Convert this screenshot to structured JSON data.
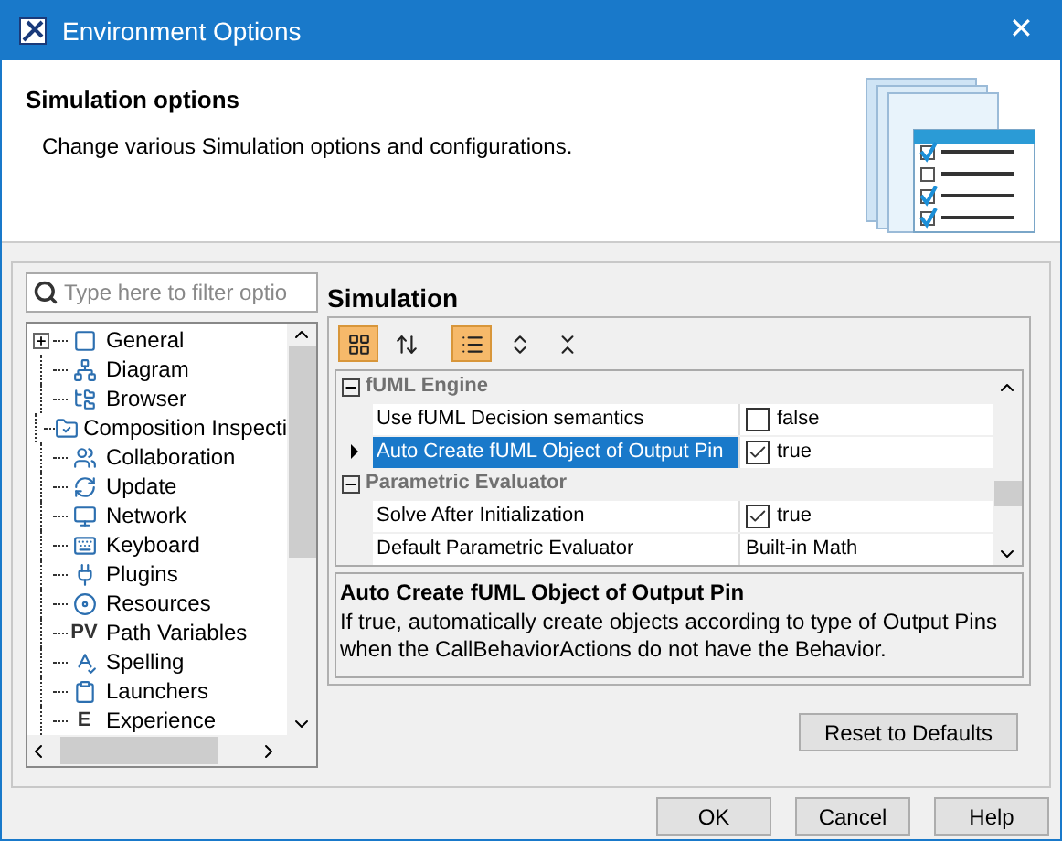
{
  "window": {
    "title": "Environment Options",
    "close": "✕"
  },
  "header": {
    "title": "Simulation options",
    "description": "Change various Simulation options and configurations."
  },
  "search": {
    "placeholder": "Type here to filter optio"
  },
  "tree": [
    {
      "label": "General",
      "expandable": true
    },
    {
      "label": "Diagram"
    },
    {
      "label": "Browser"
    },
    {
      "label": "Composition Inspecti"
    },
    {
      "label": "Collaboration"
    },
    {
      "label": "Update"
    },
    {
      "label": "Network"
    },
    {
      "label": "Keyboard"
    },
    {
      "label": "Plugins"
    },
    {
      "label": "Resources"
    },
    {
      "label": "Path Variables",
      "icon_text": "PV"
    },
    {
      "label": "Spelling"
    },
    {
      "label": "Launchers"
    },
    {
      "label": "Experience",
      "icon_text": "E"
    }
  ],
  "panel": {
    "title": "Simulation",
    "toolbar": [
      {
        "selected": true
      },
      {
        "selected": false
      },
      {
        "selected": true
      },
      {
        "selected": false
      },
      {
        "selected": false
      }
    ],
    "groups": [
      {
        "name": "fUML Engine",
        "expanded": true,
        "rows": [
          {
            "name": "Use fUML Decision semantics",
            "kind": "checkbox",
            "checked": false,
            "value": "false",
            "selected": false
          },
          {
            "name": "Auto Create fUML Object of Output Pin",
            "kind": "checkbox",
            "checked": true,
            "value": "true",
            "selected": true
          }
        ]
      },
      {
        "name": "Parametric Evaluator",
        "expanded": true,
        "rows": [
          {
            "name": "Solve After Initialization",
            "kind": "checkbox",
            "checked": true,
            "value": "true",
            "selected": false
          },
          {
            "name": "Default Parametric Evaluator",
            "kind": "text",
            "value": "Built-in Math",
            "selected": false
          }
        ]
      }
    ],
    "description": {
      "title": "Auto Create fUML Object of Output Pin",
      "text": "If true, automatically create objects according to type of Output Pins when the CallBehaviorActions do not have the Behavior."
    },
    "reset_button": "Reset to Defaults"
  },
  "buttons": [
    "OK",
    "Cancel",
    "Help"
  ]
}
